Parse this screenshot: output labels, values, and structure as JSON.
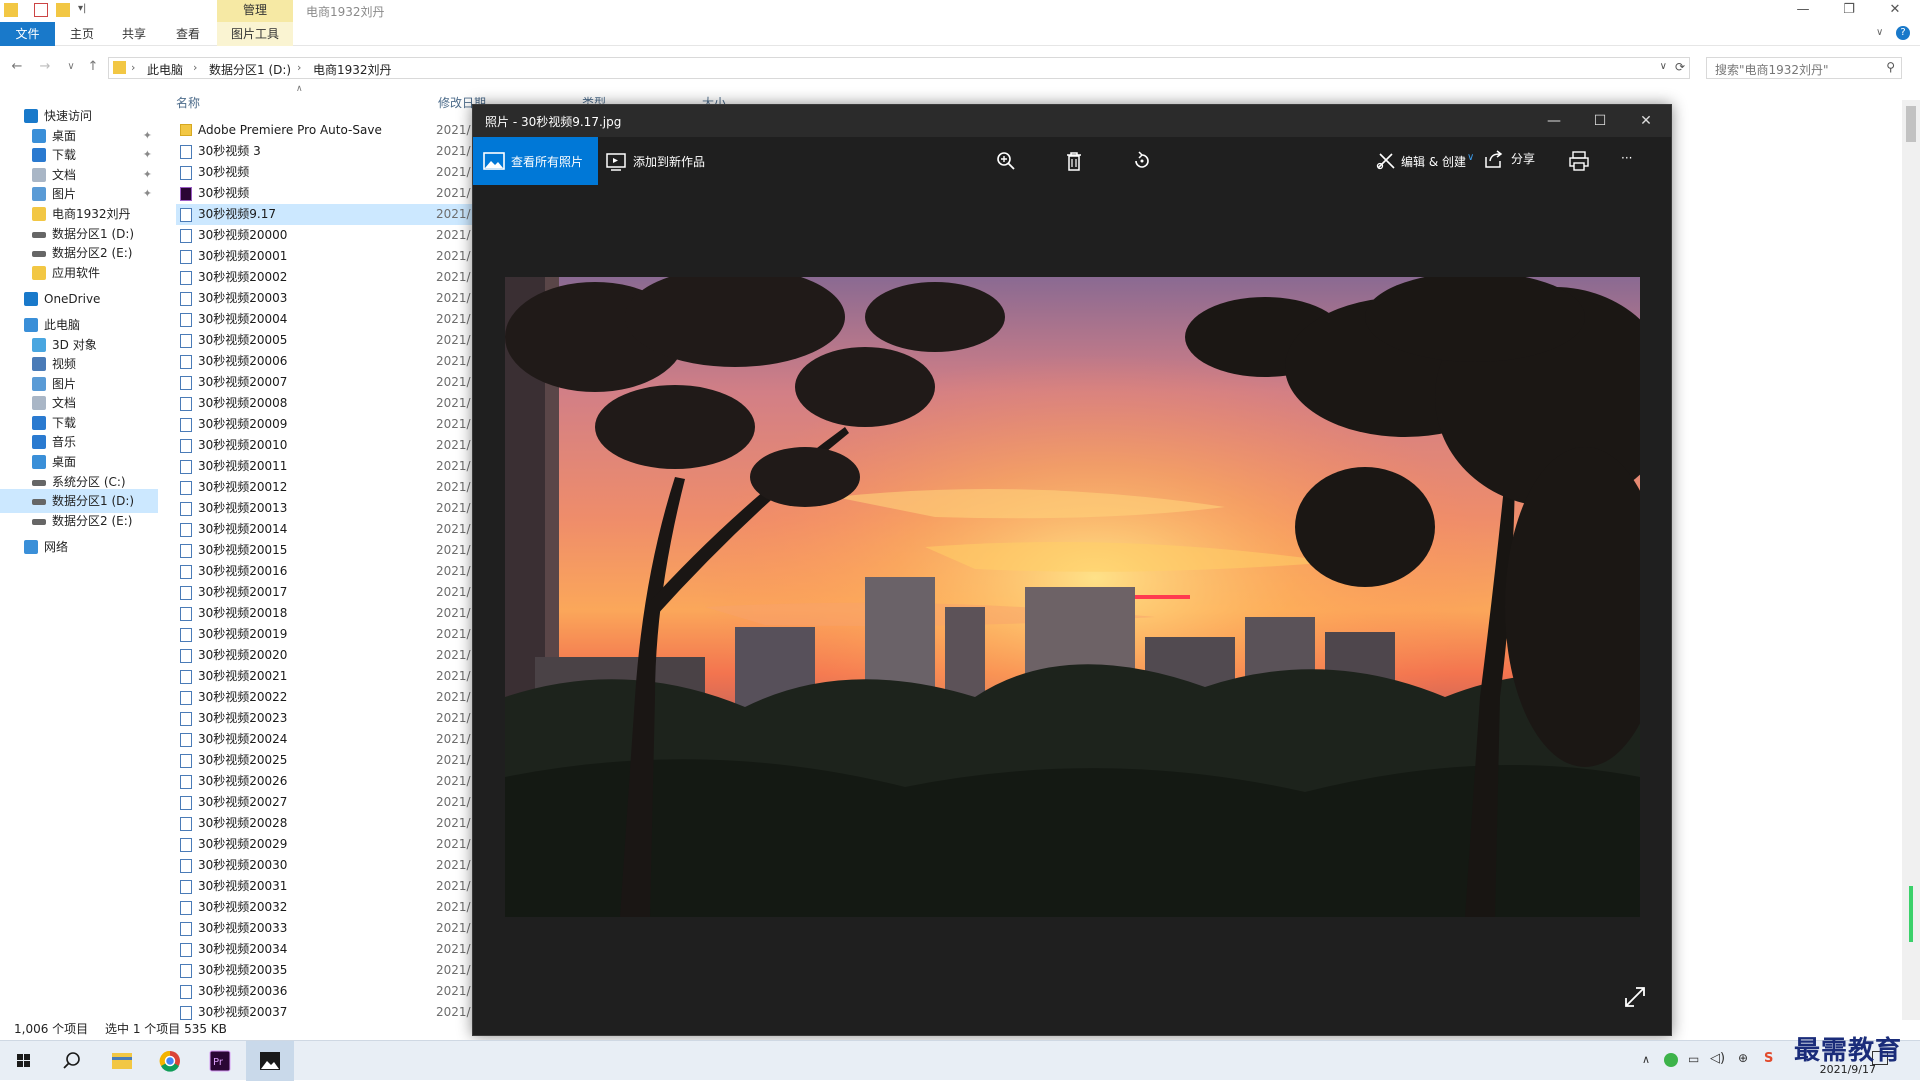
{
  "window": {
    "title": "电商1932刘丹",
    "context_tab": "管理",
    "controls": {
      "minimize": "—",
      "restore": "❐",
      "close": "✕"
    }
  },
  "ribbon": {
    "tabs": [
      "文件",
      "主页",
      "共享",
      "查看",
      "图片工具"
    ]
  },
  "address": {
    "breadcrumbs": [
      "此电脑",
      "数据分区1 (D:)",
      "电商1932刘丹"
    ],
    "search_placeholder": "搜索\"电商1932刘丹\""
  },
  "nav": {
    "items": [
      {
        "label": "快速访问",
        "icon": "star-icon",
        "level": 0
      },
      {
        "label": "桌面",
        "icon": "desktop-icon",
        "level": 1,
        "pinned": true
      },
      {
        "label": "下载",
        "icon": "download-icon",
        "level": 1,
        "pinned": true
      },
      {
        "label": "文档",
        "icon": "document-icon",
        "level": 1,
        "pinned": true
      },
      {
        "label": "图片",
        "icon": "picture-icon",
        "level": 1,
        "pinned": true
      },
      {
        "label": "电商1932刘丹",
        "icon": "folder-icon",
        "level": 1
      },
      {
        "label": "数据分区1 (D:)",
        "icon": "drive-icon",
        "level": 1
      },
      {
        "label": "数据分区2 (E:)",
        "icon": "drive-icon",
        "level": 1
      },
      {
        "label": "应用软件",
        "icon": "folder-icon",
        "level": 1
      },
      {
        "label": "OneDrive",
        "icon": "cloud-icon",
        "level": 0
      },
      {
        "label": "此电脑",
        "icon": "computer-icon",
        "level": 0
      },
      {
        "label": "3D 对象",
        "icon": "cube-icon",
        "level": 1
      },
      {
        "label": "视频",
        "icon": "video-icon",
        "level": 1
      },
      {
        "label": "图片",
        "icon": "picture-icon",
        "level": 1
      },
      {
        "label": "文档",
        "icon": "document-icon",
        "level": 1
      },
      {
        "label": "下载",
        "icon": "download-icon",
        "level": 1
      },
      {
        "label": "音乐",
        "icon": "music-icon",
        "level": 1
      },
      {
        "label": "桌面",
        "icon": "desktop-icon",
        "level": 1
      },
      {
        "label": "系统分区 (C:)",
        "icon": "drive-icon",
        "level": 1
      },
      {
        "label": "数据分区1 (D:)",
        "icon": "drive-icon",
        "level": 1,
        "selected": true
      },
      {
        "label": "数据分区2 (E:)",
        "icon": "drive-icon",
        "level": 1
      },
      {
        "label": "网络",
        "icon": "network-icon",
        "level": 0
      }
    ]
  },
  "list": {
    "columns": [
      "名称",
      "修改日期",
      "类型",
      "大小"
    ],
    "date_prefix": "2021/",
    "files": [
      {
        "name": "Adobe Premiere Pro Auto-Save",
        "type": "folder"
      },
      {
        "name": "30秒视频 3",
        "type": "file"
      },
      {
        "name": "30秒视频",
        "type": "file"
      },
      {
        "name": "30秒视频",
        "type": "premiere"
      },
      {
        "name": "30秒视频9.17",
        "type": "file",
        "selected": true
      },
      {
        "name": "30秒视频20000",
        "type": "file"
      },
      {
        "name": "30秒视频20001",
        "type": "file"
      },
      {
        "name": "30秒视频20002",
        "type": "file"
      },
      {
        "name": "30秒视频20003",
        "type": "file"
      },
      {
        "name": "30秒视频20004",
        "type": "file"
      },
      {
        "name": "30秒视频20005",
        "type": "file"
      },
      {
        "name": "30秒视频20006",
        "type": "file"
      },
      {
        "name": "30秒视频20007",
        "type": "file"
      },
      {
        "name": "30秒视频20008",
        "type": "file"
      },
      {
        "name": "30秒视频20009",
        "type": "file"
      },
      {
        "name": "30秒视频20010",
        "type": "file"
      },
      {
        "name": "30秒视频20011",
        "type": "file"
      },
      {
        "name": "30秒视频20012",
        "type": "file"
      },
      {
        "name": "30秒视频20013",
        "type": "file"
      },
      {
        "name": "30秒视频20014",
        "type": "file"
      },
      {
        "name": "30秒视频20015",
        "type": "file"
      },
      {
        "name": "30秒视频20016",
        "type": "file"
      },
      {
        "name": "30秒视频20017",
        "type": "file"
      },
      {
        "name": "30秒视频20018",
        "type": "file"
      },
      {
        "name": "30秒视频20019",
        "type": "file"
      },
      {
        "name": "30秒视频20020",
        "type": "file"
      },
      {
        "name": "30秒视频20021",
        "type": "file"
      },
      {
        "name": "30秒视频20022",
        "type": "file"
      },
      {
        "name": "30秒视频20023",
        "type": "file"
      },
      {
        "name": "30秒视频20024",
        "type": "file"
      },
      {
        "name": "30秒视频20025",
        "type": "file"
      },
      {
        "name": "30秒视频20026",
        "type": "file"
      },
      {
        "name": "30秒视频20027",
        "type": "file"
      },
      {
        "name": "30秒视频20028",
        "type": "file"
      },
      {
        "name": "30秒视频20029",
        "type": "file"
      },
      {
        "name": "30秒视频20030",
        "type": "file"
      },
      {
        "name": "30秒视频20031",
        "type": "file"
      },
      {
        "name": "30秒视频20032",
        "type": "file"
      },
      {
        "name": "30秒视频20033",
        "type": "file"
      },
      {
        "name": "30秒视频20034",
        "type": "file"
      },
      {
        "name": "30秒视频20035",
        "type": "file"
      },
      {
        "name": "30秒视频20036",
        "type": "file"
      },
      {
        "name": "30秒视频20037",
        "type": "file"
      }
    ]
  },
  "status": {
    "count": "1,006 个项目",
    "selection": "选中 1 个项目  535 KB"
  },
  "photos": {
    "title": "照片 - 30秒视频9.17.jpg",
    "view_all_label": "查看所有照片",
    "add_to_creation_label": "添加到新作品",
    "edit_create_label": "编辑 & 创建",
    "share_label": "分享",
    "more_label": "···",
    "accent": "#0078d7"
  },
  "taskbar": {
    "time": "2021/9/17",
    "watermark": "最需教育"
  }
}
